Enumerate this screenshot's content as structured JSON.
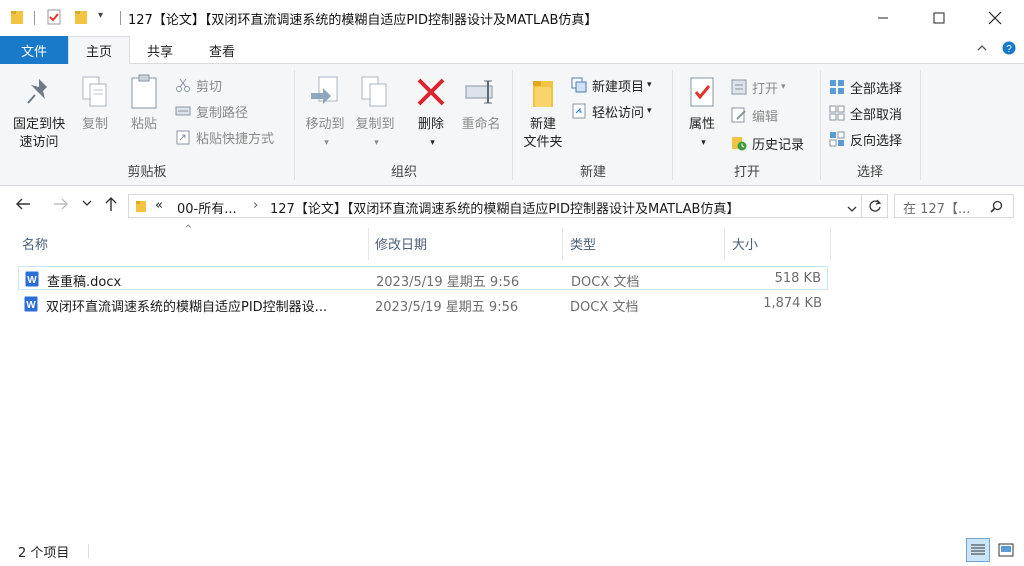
{
  "title": "127【论文】【双闭环直流调速系统的模糊自适应PID控制器设计及MATLAB仿真】",
  "tabs": {
    "file": "文件",
    "home": "主页",
    "share": "共享",
    "view": "查看"
  },
  "ribbon": {
    "clipboard": {
      "label": "剪贴板",
      "pin": "固定到快速访问",
      "pin_line1": "固定到快",
      "pin_line2": "速访问",
      "copy": "复制",
      "paste": "粘贴",
      "cut": "剪切",
      "copy_path": "复制路径",
      "paste_shortcut": "粘贴快捷方式"
    },
    "organize": {
      "label": "组织",
      "move_to": "移动到",
      "copy_to": "复制到",
      "delete": "删除",
      "rename": "重命名"
    },
    "new": {
      "label": "新建",
      "new_folder_line1": "新建",
      "new_folder_line2": "文件夹",
      "new_item": "新建项目",
      "easy_access": "轻松访问"
    },
    "open": {
      "label": "打开",
      "properties": "属性",
      "open": "打开",
      "edit": "编辑",
      "history": "历史记录"
    },
    "select": {
      "label": "选择",
      "select_all": "全部选择",
      "select_none": "全部取消",
      "invert": "反向选择"
    }
  },
  "address": {
    "overflow": "«",
    "crumb1": "00-所有...",
    "crumb2": "127【论文】【双闭环直流调速系统的模糊自适应PID控制器设计及MATLAB仿真】",
    "search_placeholder": "在 127【..."
  },
  "columns": {
    "name": "名称",
    "modified": "修改日期",
    "type": "类型",
    "size": "大小"
  },
  "files": [
    {
      "name": "查重稿.docx",
      "modified": "2023/5/19 星期五 9:56",
      "type": "DOCX 文档",
      "size": "518 KB"
    },
    {
      "name": "双闭环直流调速系统的模糊自适应PID控制器设...",
      "modified": "2023/5/19 星期五 9:56",
      "type": "DOCX 文档",
      "size": "1,874 KB"
    }
  ],
  "status": {
    "count": "2 个项目"
  },
  "colors": {
    "file_tab": "#1979ca",
    "ribbon_bg": "#f5f6f7",
    "header_text": "#4c607a",
    "selection_border": "#cce8ff"
  }
}
